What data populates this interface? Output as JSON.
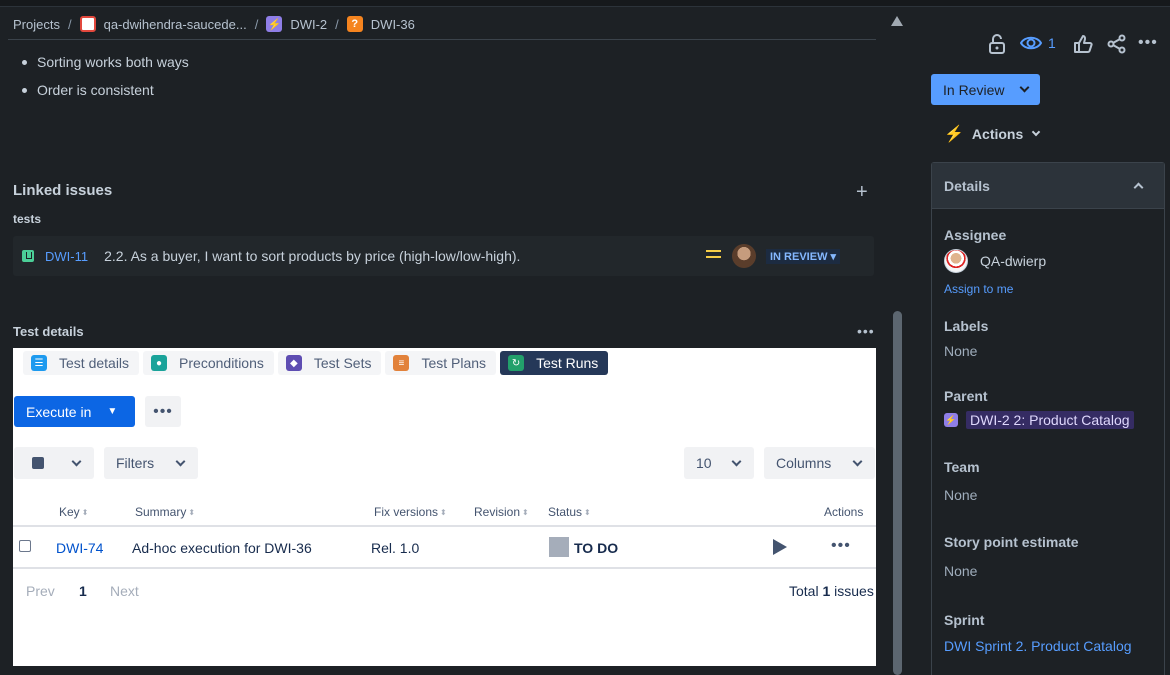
{
  "breadcrumb": {
    "projects": "Projects",
    "project": "qa-dwihendra-saucede...",
    "epic": "DWI-2",
    "issue": "DWI-36"
  },
  "description_bullets": [
    "Sorting works both ways",
    "Order is consistent"
  ],
  "linked_issues": {
    "title": "Linked issues",
    "relation": "tests",
    "item": {
      "key": "DWI-11",
      "summary": "2.2. As a buyer, I want to sort products by price (high-low/low-high).",
      "status": "IN REVIEW"
    }
  },
  "test_details": {
    "title": "Test details",
    "tabs": [
      "Test details",
      "Preconditions",
      "Test Sets",
      "Test Plans",
      "Test Runs"
    ],
    "active_tab": "Test Runs",
    "execute_label": "Execute in",
    "filters_label": "Filters",
    "page_size": "10",
    "columns_label": "Columns",
    "headers": {
      "key": "Key",
      "summary": "Summary",
      "fix_versions": "Fix versions",
      "revision": "Revision",
      "status": "Status",
      "actions": "Actions"
    },
    "rows": [
      {
        "key": "DWI-74",
        "summary": "Ad-hoc execution for DWI-36",
        "fix_version": "Rel. 1.0",
        "status": "TO DO"
      }
    ],
    "pager": {
      "prev": "Prev",
      "page": "1",
      "next": "Next"
    },
    "total": {
      "prefix": "Total",
      "count": "1",
      "suffix": "issues"
    }
  },
  "sidebar": {
    "watch_count": "1",
    "status_button": "In Review",
    "actions_label": "Actions",
    "details_title": "Details",
    "assignee_label": "Assignee",
    "assignee": "QA-dwierp",
    "assign_to_me": "Assign to me",
    "labels_label": "Labels",
    "labels_value": "None",
    "parent_label": "Parent",
    "parent_value": "DWI-2 2: Product Catalog",
    "team_label": "Team",
    "team_value": "None",
    "story_points_label": "Story point estimate",
    "story_points_value": "None",
    "sprint_label": "Sprint",
    "sprint_value": "DWI Sprint 2. Product Catalog"
  },
  "colors": {
    "background": "#1d2125",
    "accent": "#579dff",
    "primary_button": "#0c66e4",
    "epic": "#8f7ee7",
    "story": "#4bce97",
    "priority_medium": "#f5cd47"
  }
}
